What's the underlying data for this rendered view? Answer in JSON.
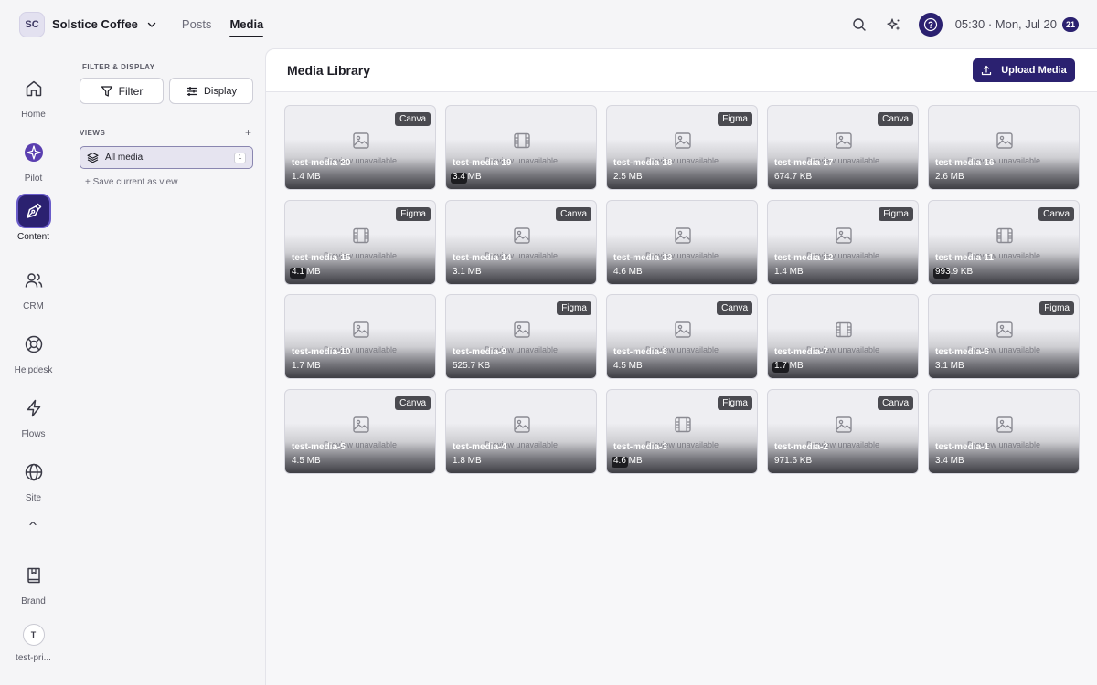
{
  "workspace": {
    "initials": "SC",
    "name": "Solstice Coffee"
  },
  "nav": {
    "posts": "Posts",
    "media": "Media"
  },
  "status": {
    "clock": "05:30 · Mon, Jul 20",
    "badge": "21"
  },
  "rail": {
    "home": "Home",
    "pilot": "Pilot",
    "content": "Content",
    "crm": "CRM",
    "helpdesk": "Helpdesk",
    "flows": "Flows",
    "site": "Site",
    "brand": "Brand",
    "user_initial": "T",
    "user_name": "test-pri..."
  },
  "panel": {
    "title": "FILTER & DISPLAY",
    "filter_label": "Filter",
    "display_label": "Display",
    "views_title": "VIEWS",
    "views_add": "+",
    "view_all": "All media",
    "view_all_count": "1",
    "save_view": "+ Save current as view"
  },
  "main": {
    "title": "Media Library",
    "upload_label": "Upload Media"
  },
  "preview_text": "Preview unavailable",
  "media": [
    {
      "name": "test-media-20",
      "size": "1.4 MB",
      "tag": "Canva",
      "kind": "image"
    },
    {
      "name": "test-media-19",
      "size": "3.4 MB",
      "tag": "",
      "kind": "video"
    },
    {
      "name": "test-media-18",
      "size": "2.5 MB",
      "tag": "Figma",
      "kind": "image"
    },
    {
      "name": "test-media-17",
      "size": "674.7 KB",
      "tag": "Canva",
      "kind": "image"
    },
    {
      "name": "test-media-16",
      "size": "2.6 MB",
      "tag": "",
      "kind": "image"
    },
    {
      "name": "test-media-15",
      "size": "4.1 MB",
      "tag": "Figma",
      "kind": "video"
    },
    {
      "name": "test-media-14",
      "size": "3.1 MB",
      "tag": "Canva",
      "kind": "image"
    },
    {
      "name": "test-media-13",
      "size": "4.6 MB",
      "tag": "",
      "kind": "image"
    },
    {
      "name": "test-media-12",
      "size": "1.4 MB",
      "tag": "Figma",
      "kind": "image"
    },
    {
      "name": "test-media-11",
      "size": "993.9 KB",
      "tag": "Canva",
      "kind": "video"
    },
    {
      "name": "test-media-10",
      "size": "1.7 MB",
      "tag": "",
      "kind": "image"
    },
    {
      "name": "test-media-9",
      "size": "525.7 KB",
      "tag": "Figma",
      "kind": "image"
    },
    {
      "name": "test-media-8",
      "size": "4.5 MB",
      "tag": "Canva",
      "kind": "image"
    },
    {
      "name": "test-media-7",
      "size": "1.7 MB",
      "tag": "",
      "kind": "video"
    },
    {
      "name": "test-media-6",
      "size": "3.1 MB",
      "tag": "Figma",
      "kind": "image"
    },
    {
      "name": "test-media-5",
      "size": "4.5 MB",
      "tag": "Canva",
      "kind": "image"
    },
    {
      "name": "test-media-4",
      "size": "1.8 MB",
      "tag": "",
      "kind": "image"
    },
    {
      "name": "test-media-3",
      "size": "4.6 MB",
      "tag": "Figma",
      "kind": "video"
    },
    {
      "name": "test-media-2",
      "size": "971.6 KB",
      "tag": "Canva",
      "kind": "image"
    },
    {
      "name": "test-media-1",
      "size": "3.4 MB",
      "tag": "",
      "kind": "image"
    }
  ]
}
